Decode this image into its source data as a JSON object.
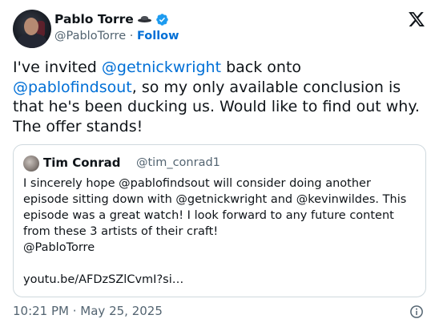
{
  "author": {
    "name": "Pablo Torre",
    "handle": "@PabloTorre",
    "separator": "·",
    "follow_label": "Follow"
  },
  "icons": {
    "hat": "hat-emoji-icon",
    "verified": "verified-badge-icon",
    "platform": "x-logo-icon",
    "info": "info-icon"
  },
  "colors": {
    "link": "#006fd6",
    "secondary_text": "#536471",
    "border": "#cfd9de",
    "verified": "#1d9bf0"
  },
  "tweet": {
    "text_1": "I've invited ",
    "mention_1": "@getnickwright",
    "text_2": " back onto ",
    "mention_2": "@pablofindsout",
    "text_3": ", so my only available conclusion is that he's been ducking us. Would like to find out why. The offer stands!"
  },
  "quote": {
    "name": "Tim Conrad",
    "handle": "@tim_conrad1",
    "text": "I sincerely hope @pablofindsout will consider doing another episode sitting down with @getnickwright and @kevinwildes. This episode was a great watch!  I look forward to any future content from these 3 artists of their craft!\n@PabloTorre\n\nyoutu.be/AFDzSZlCvmI?si…"
  },
  "footer": {
    "timestamp": "10:21 PM · May 25, 2025"
  }
}
